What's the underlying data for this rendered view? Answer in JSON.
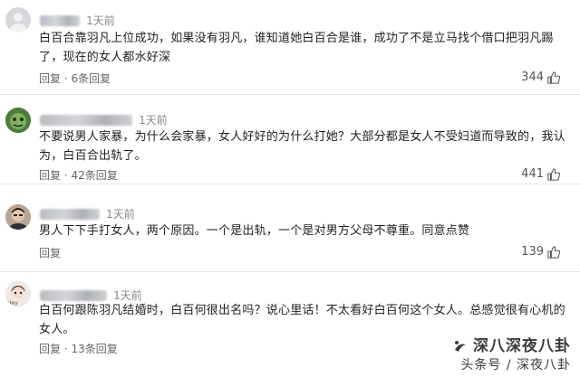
{
  "comments": [
    {
      "time": "1天前",
      "text": "白百合靠羽凡上位成功，如果没有羽凡，谁知道她白百合是谁，成功了不是立马找个借口把羽凡踢了，现在的女人都水好深",
      "reply_label": "回复",
      "reply_count": "6条回复",
      "likes": "344"
    },
    {
      "time": "1天前",
      "text": "不要说男人家暴，为什么会家暴，女人好好的为什么打她？大部分都是女人不受妇道而导致的，我认为，白百合出轨了。",
      "reply_label": "回复",
      "reply_count": "42条回复",
      "likes": "441"
    },
    {
      "time": "1天前",
      "text": "男人下下手打女人，两个原因。一个是出轨，一个是对男方父母不尊重。同意点赞",
      "reply_label": "回复",
      "reply_count": "",
      "likes": "139"
    },
    {
      "time": "1天前",
      "text": "白百何跟陈羽凡结婚时，白百何很出名吗？说心里话！不太看好白百何这个女人。总感觉很有心机的女人。",
      "reply_label": "回复",
      "reply_count": "13条回复",
      "likes": ""
    }
  ],
  "watermark": {
    "line1": "深八深夜八卦",
    "line2": "头条号 / 深夜八卦"
  },
  "colors": {
    "text": "#222222",
    "meta": "#888888",
    "divider": "#e8e8e8"
  }
}
